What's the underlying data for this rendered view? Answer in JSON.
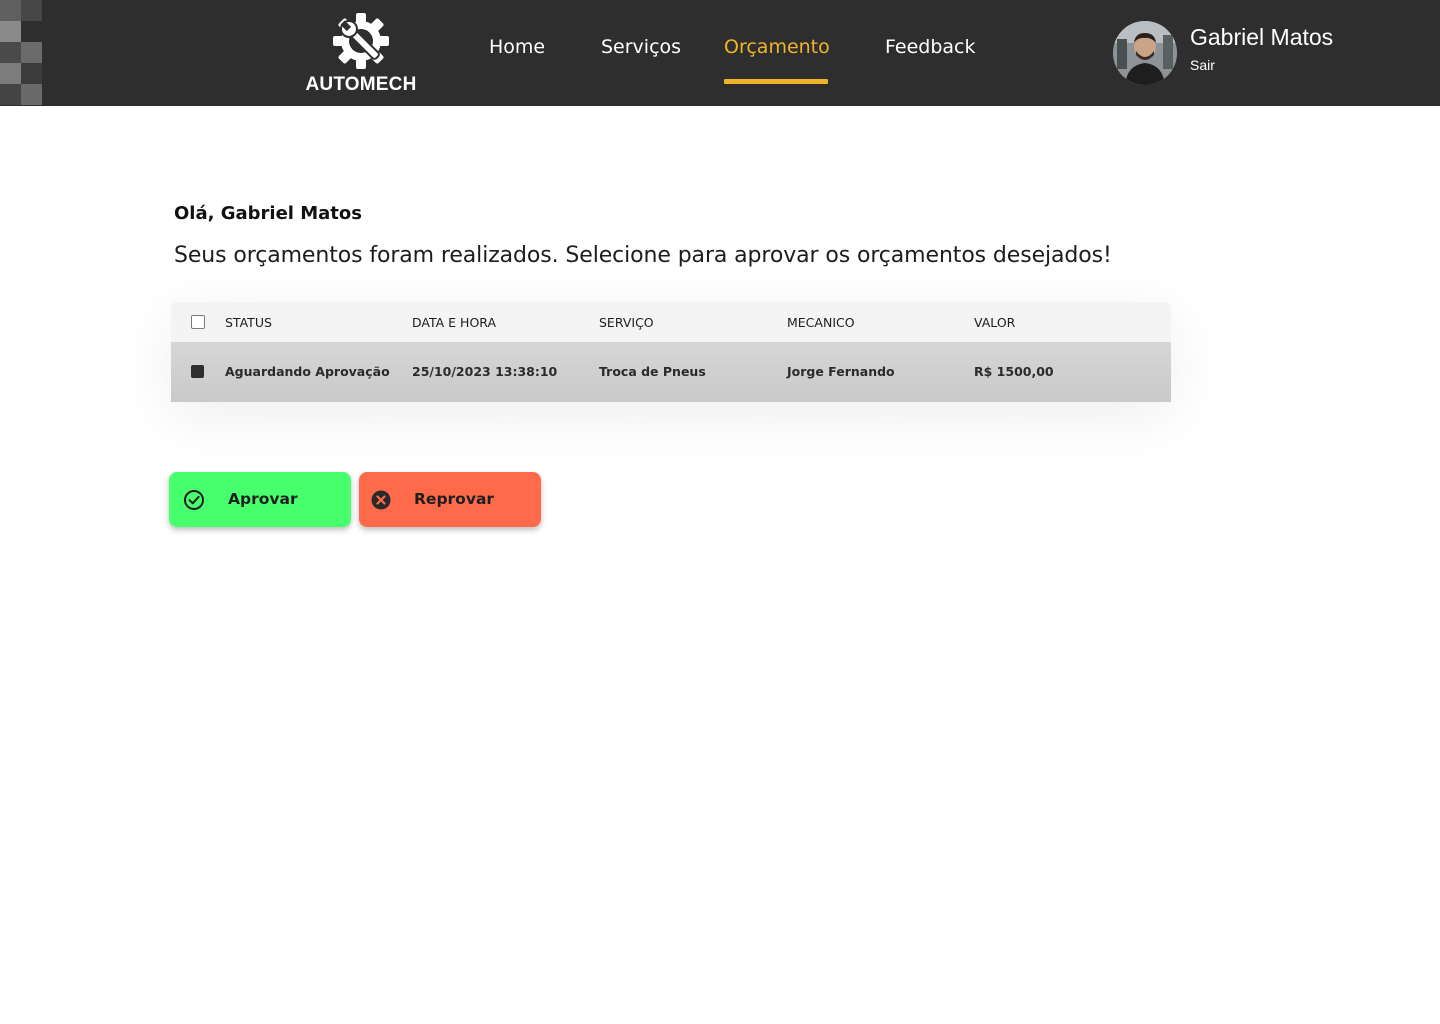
{
  "brand": {
    "name": "AUTOMECH",
    "logo_icon": "gear-wrench-icon",
    "colors": {
      "header_bg": "#2e2e2e",
      "accent": "#f0b42c",
      "approve": "#48ff6e",
      "reject": "#ff6a4a"
    }
  },
  "nav": {
    "items": [
      {
        "label": "Home",
        "active": false
      },
      {
        "label": "Serviços",
        "active": false
      },
      {
        "label": "Orçamento",
        "active": true
      },
      {
        "label": "Feedback",
        "active": false
      }
    ]
  },
  "user": {
    "name": "Gabriel Matos",
    "logout_label": "Sair",
    "avatar_icon": "user-avatar-photo"
  },
  "main": {
    "greeting": "Olá, Gabriel Matos",
    "subtitle": "Seus orçamentos foram realizados. Selecione para aprovar os orçamentos desejados!"
  },
  "table": {
    "columns": [
      "STATUS",
      "DATA E HORA",
      "SERVIÇO",
      "MECANICO",
      "VALOR"
    ],
    "select_all_checked": false,
    "rows": [
      {
        "selected": true,
        "status": "Aguardando Aprovação",
        "datetime": "25/10/2023 13:38:10",
        "service": "Troca de Pneus",
        "mechanic": "Jorge Fernando",
        "value": "R$ 1500,00"
      }
    ]
  },
  "actions": {
    "approve_label": "Aprovar",
    "approve_icon": "check-circle-icon",
    "reject_label": "Reprovar",
    "reject_icon": "x-circle-icon"
  }
}
